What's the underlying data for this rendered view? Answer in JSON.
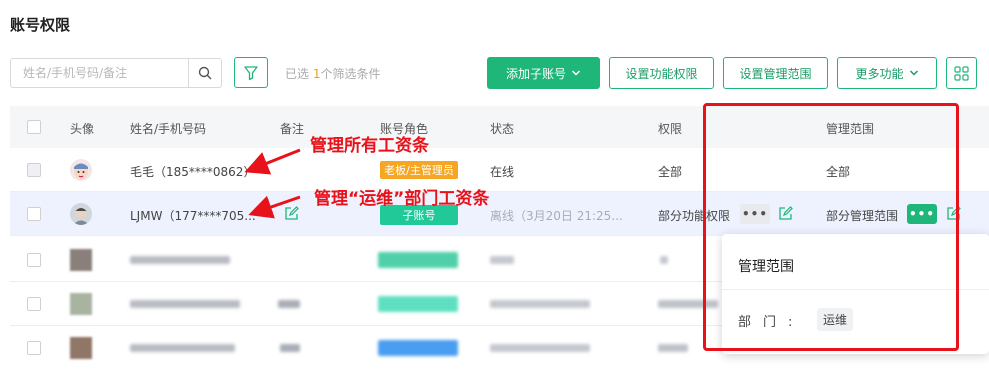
{
  "page": {
    "title": "账号权限"
  },
  "toolbar": {
    "search_placeholder": "姓名/手机号码/备注",
    "filter_prefix": "已选",
    "filter_count": "1",
    "filter_suffix": "个筛选条件",
    "add_sub_account": "添加子账号",
    "set_permissions": "设置功能权限",
    "set_scope": "设置管理范围",
    "more_functions": "更多功能"
  },
  "table": {
    "headers": {
      "avatar": "头像",
      "name_phone": "姓名/手机号码",
      "remark": "备注",
      "role": "账号角色",
      "status": "状态",
      "permission": "权限",
      "scope": "管理范围"
    },
    "rows": [
      {
        "name": "毛毛（185****0862）",
        "role": "老板/主管理员",
        "status": "在线",
        "permission": "全部",
        "scope": "全部"
      },
      {
        "name": "LJMW（177****705...",
        "role": "子账号",
        "status": "离线（3月20日 21:25...",
        "permission": "部分功能权限",
        "scope": "部分管理范围"
      }
    ]
  },
  "popover": {
    "title": "管理范围",
    "dept_label": "部门:",
    "dept_value": "运维"
  },
  "annotations": {
    "top": "管理所有工资条",
    "bottom": "管理“运维”部门工资条"
  },
  "colors": {
    "accent": "#1fb679",
    "annotation": "#e8121a",
    "boss_tag": "#f6a623",
    "sub_tag": "#20c997"
  }
}
